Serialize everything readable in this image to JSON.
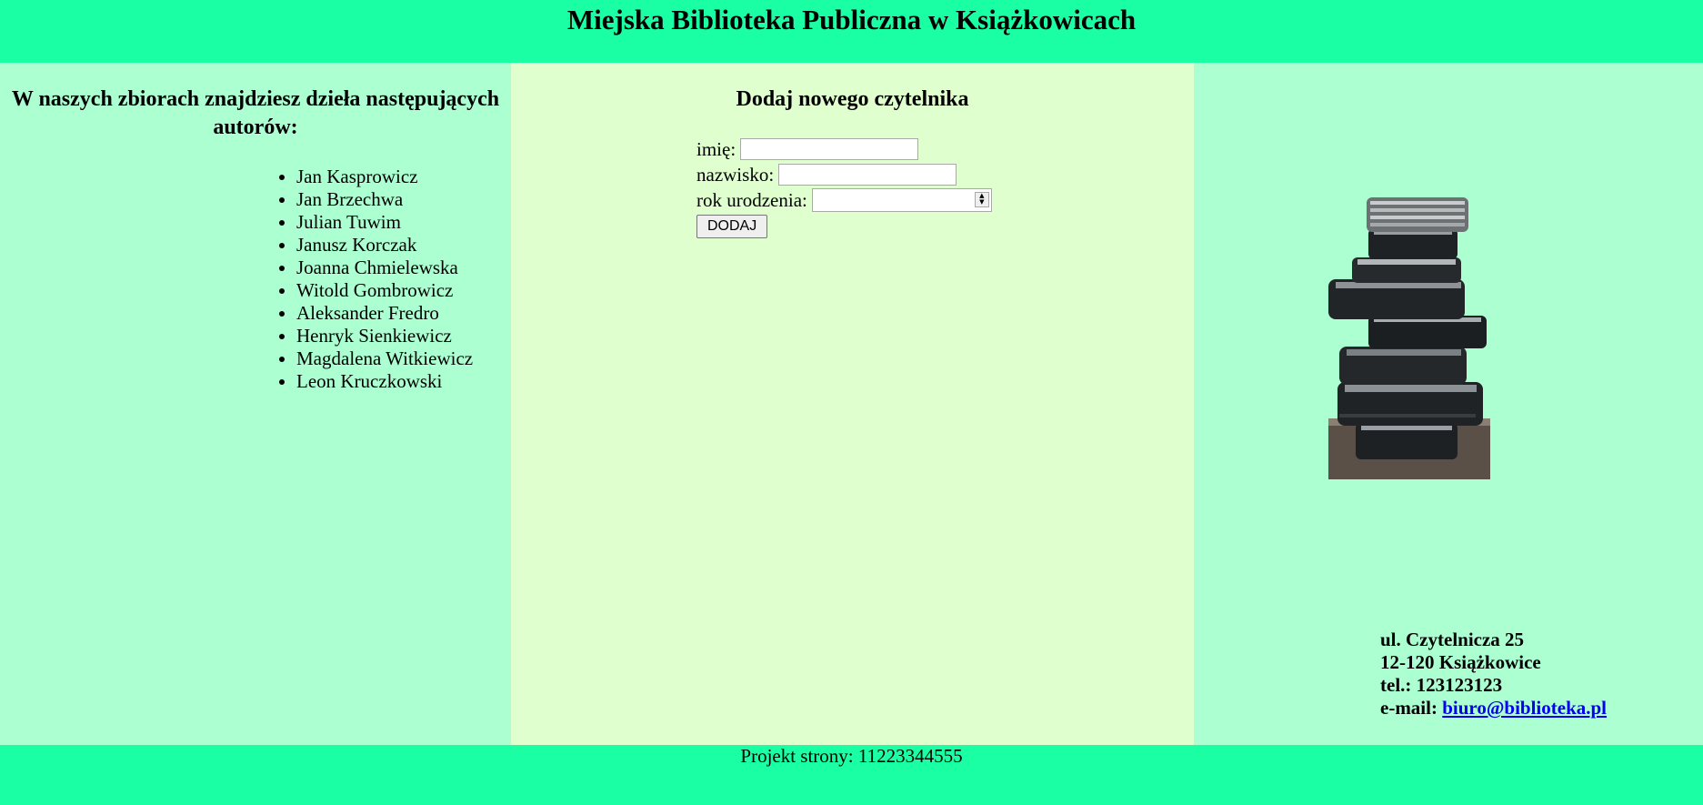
{
  "header": {
    "title": "Miejska Biblioteka Publiczna w Książkowicach"
  },
  "left": {
    "heading": "W naszych zbiorach znajdziesz dzieła następujących autorów:",
    "authors": [
      "Jan Kasprowicz",
      "Jan Brzechwa",
      "Julian Tuwim",
      "Janusz Korczak",
      "Joanna Chmielewska",
      "Witold Gombrowicz",
      "Aleksander Fredro",
      "Henryk Sienkiewicz",
      "Magdalena Witkiewicz",
      "Leon Kruczkowski"
    ]
  },
  "middle": {
    "heading": "Dodaj nowego czytelnika",
    "form": {
      "first_name_label": "imię:",
      "first_name_value": "",
      "last_name_label": "nazwisko:",
      "last_name_value": "",
      "birth_year_label": "rok urodzenia:",
      "birth_year_value": "",
      "submit_label": "DODAJ"
    }
  },
  "right": {
    "image_alt": "stack of books",
    "address": {
      "street": "ul. Czytelnicza 25",
      "city": "12-120 Książkowice",
      "phone": "tel.: 123123123",
      "email_label": "e-mail: ",
      "email": "biuro@biblioteka.pl"
    }
  },
  "footer": {
    "text": "Projekt strony: 11223344555"
  },
  "colors": {
    "header_footer_bg": "#1affa3",
    "side_bg": "#acffd1",
    "middle_bg": "#dfffcf",
    "link": "#0000ee"
  }
}
